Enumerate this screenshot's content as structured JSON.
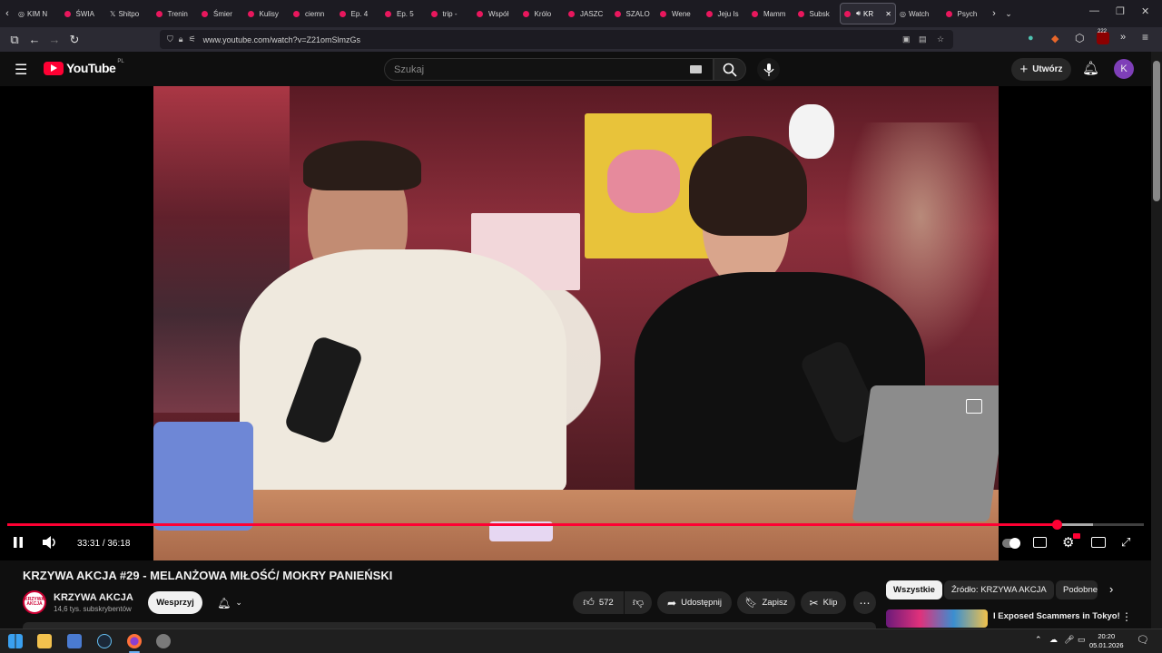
{
  "browser": {
    "tabs": [
      {
        "label": "KIM N",
        "type": "other"
      },
      {
        "label": "ŚWIA",
        "type": "yt"
      },
      {
        "label": "Shitpo",
        "type": "x"
      },
      {
        "label": "Trenin",
        "type": "yt"
      },
      {
        "label": "Śmier",
        "type": "yt"
      },
      {
        "label": "Kulisy",
        "type": "yt"
      },
      {
        "label": "ciemn",
        "type": "yt"
      },
      {
        "label": "Ep. 4",
        "type": "yt"
      },
      {
        "label": "Ep. 5",
        "type": "yt"
      },
      {
        "label": "trip -",
        "type": "yt"
      },
      {
        "label": "Współ",
        "type": "yt"
      },
      {
        "label": "Królo",
        "type": "yt"
      },
      {
        "label": "JASZC",
        "type": "yt"
      },
      {
        "label": "SZALO",
        "type": "yt"
      },
      {
        "label": "Wene",
        "type": "yt"
      },
      {
        "label": "Jeju Is",
        "type": "yt"
      },
      {
        "label": "Mamm",
        "type": "yt"
      },
      {
        "label": "Subsk",
        "type": "yt"
      },
      {
        "label": "KR",
        "type": "active"
      },
      {
        "label": "Watch",
        "type": "other"
      },
      {
        "label": "Psych",
        "type": "yt"
      }
    ],
    "url": "www.youtube.com/watch?v=Z21omSlmzGs",
    "extension_badge": "222"
  },
  "youtube": {
    "logo": "YouTube",
    "region": "PL",
    "search_placeholder": "Szukaj",
    "create_label": "Utwórz",
    "avatar_letter": "K"
  },
  "player": {
    "current_time": "33:31",
    "duration": "36:18",
    "progress_fraction": 0.923,
    "buffered_fraction": 0.955
  },
  "video": {
    "title": "KRZYWA AKCJA #29 - MELANŻOWA MIŁOŚĆ/ MOKRY PANIEŃSKI",
    "channel_name": "KRZYWA AKCJA",
    "channel_logo_text": "KRZYWA AKCJA",
    "subscribers": "14,6 tys. subskrybentów",
    "support_label": "Wesprzyj",
    "likes": "572",
    "share_label": "Udostępnij",
    "save_label": "Zapisz",
    "clip_label": "Klip"
  },
  "sidebar": {
    "chips": [
      "Wszystkie",
      "Źródło: KRZYWA AKCJA",
      "Podobne"
    ],
    "recommendation_title": "I Exposed Scammers in Tokyo!"
  },
  "taskbar": {
    "time": "20:20",
    "date": "05.01.2026"
  },
  "colors": {
    "accent": "#ff0033",
    "background": "#0f0f0f",
    "chip_bg": "#272727"
  }
}
